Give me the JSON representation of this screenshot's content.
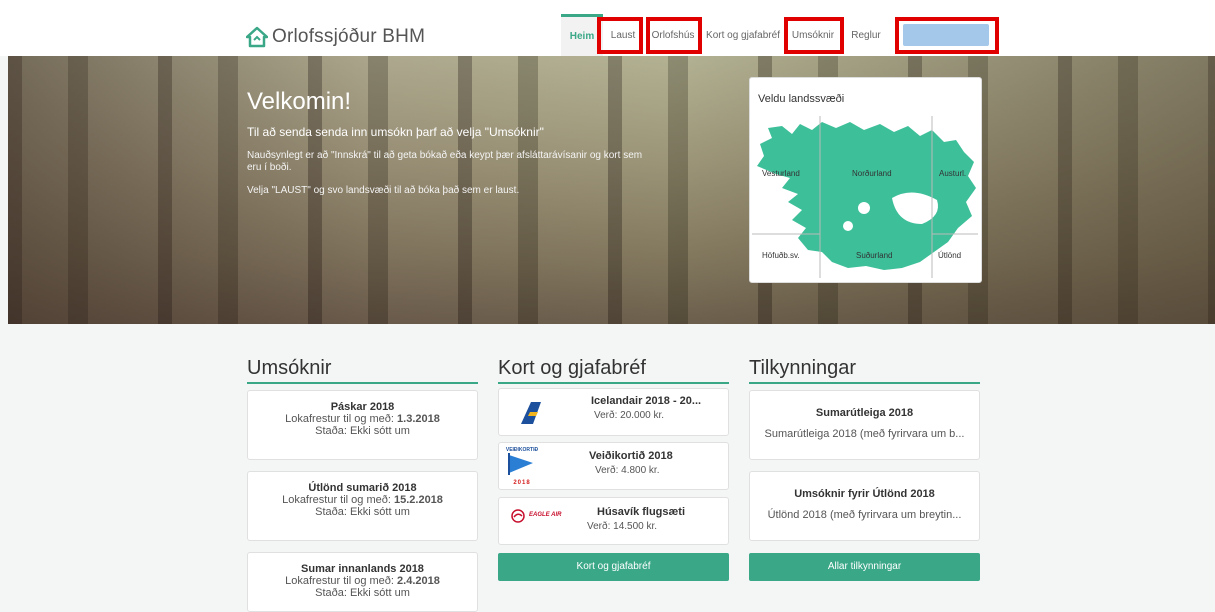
{
  "brand": {
    "name": "Orlofssjóður BHM"
  },
  "nav": {
    "home": "Heim",
    "laust": "Laust",
    "orlofshus": "Orlofshús",
    "kort": "Kort og gjafabréf",
    "umsoknir": "Umsóknir",
    "reglur": "Reglur"
  },
  "colors": {
    "accent": "#3aa787",
    "highlight": "#e00000",
    "search": "#a4c8ea",
    "map": "#3dbf99"
  },
  "hero": {
    "title": "Velkomin!",
    "subtitle": "Til að senda senda inn umsókn þarf að velja \"Umsóknir\"",
    "line1": "Nauðsynlegt er að \"Innskrá\" til að geta bókað eða keypt þær afsláttarávísanir  og kort sem eru í boði.",
    "line2": "Velja \"LAUST\" og svo landsvæði til að bóka það sem er laust."
  },
  "map": {
    "title": "Veldu landssvæði",
    "regions": {
      "west": "Vesturland",
      "north": "Norðurland",
      "east": "Austurl.",
      "capital": "Höfuðb.sv.",
      "south": "Suðurland",
      "abroad": "Útlönd"
    }
  },
  "applications": {
    "heading": "Umsóknir",
    "items": [
      {
        "title": "Páskar 2018",
        "deadline_label": "Lokafrestur til og með:",
        "deadline": "1.3.2018",
        "status": "Staða: Ekki sótt um"
      },
      {
        "title": "Útlönd sumarið 2018",
        "deadline_label": "Lokafrestur til og með:",
        "deadline": "15.2.2018",
        "status": "Staða: Ekki sótt um"
      },
      {
        "title": "Sumar innanlands 2018",
        "deadline_label": "Lokafrestur til og með:",
        "deadline": "2.4.2018",
        "status": "Staða: Ekki sótt um"
      }
    ]
  },
  "gifts": {
    "heading": "Kort og gjafabréf",
    "items": [
      {
        "title": "Icelandair 2018 - 20...",
        "price": "Verð: 20.000 kr.",
        "logo": "icelandair-logo"
      },
      {
        "title": "Veiðikortið 2018",
        "price": "Verð: 4.800 kr.",
        "logo_top": "VEIÐIKORTIÐ",
        "logo_year": "2018"
      },
      {
        "title": "Húsavík flugsæti",
        "price": "Verð: 14.500 kr.",
        "logo_text": "EAGLE AIR"
      }
    ],
    "button": "Kort og gjafabréf"
  },
  "notices": {
    "heading": "Tilkynningar",
    "items": [
      {
        "title": "Sumarútleiga 2018",
        "text": "Sumarútleiga 2018 (með fyrirvara um b..."
      },
      {
        "title": "Umsóknir fyrir Útlönd 2018",
        "text": "Útlönd 2018 (með fyrirvara um breytin..."
      }
    ],
    "button": "Allar tilkynningar"
  }
}
